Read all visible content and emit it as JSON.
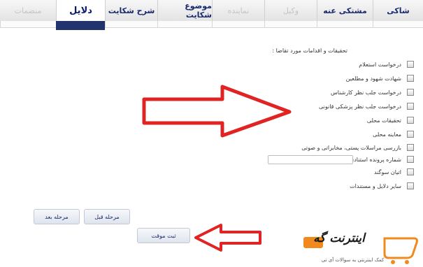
{
  "tabs": [
    {
      "label": "شاکی"
    },
    {
      "label": "مشتکی عنه"
    },
    {
      "label": "وکیل"
    },
    {
      "label": "نماینده"
    },
    {
      "label": "موضوع شکایت"
    },
    {
      "label": "شرح شکایت"
    },
    {
      "label": "دلایل"
    },
    {
      "label": "منضمات"
    }
  ],
  "form": {
    "heading": "تحقیقات و اقدامات مورد تقاضا :",
    "options": [
      {
        "label": "درخواست استعلام"
      },
      {
        "label": "شهادت شهود و مطلعین"
      },
      {
        "label": "درخواست جلب نظر کارشناس"
      },
      {
        "label": "درخواست جلب نظر پزشکی قانونی"
      },
      {
        "label": "تحقیقات محلی"
      },
      {
        "label": "معاینه محلی"
      },
      {
        "label": "بازرسی مراسلات پستی، مخابراتی و صوتی"
      },
      {
        "label": "شماره پرونده استنادی"
      },
      {
        "label": "اتیان سوگند"
      },
      {
        "label": "سایر دلایل و مستندات"
      }
    ]
  },
  "buttons": {
    "prev": "مرحله قبل",
    "next": "مرحله بعد",
    "submit": "ثبت موقت"
  },
  "watermark": {
    "brand": "اینترنت گه",
    "tagline": "کمک اینترنتی به سوالات آی تی"
  },
  "colors": {
    "tab_text": "#1a2a6e",
    "active_bar": "#22346e",
    "arrow_red": "#e02424"
  }
}
